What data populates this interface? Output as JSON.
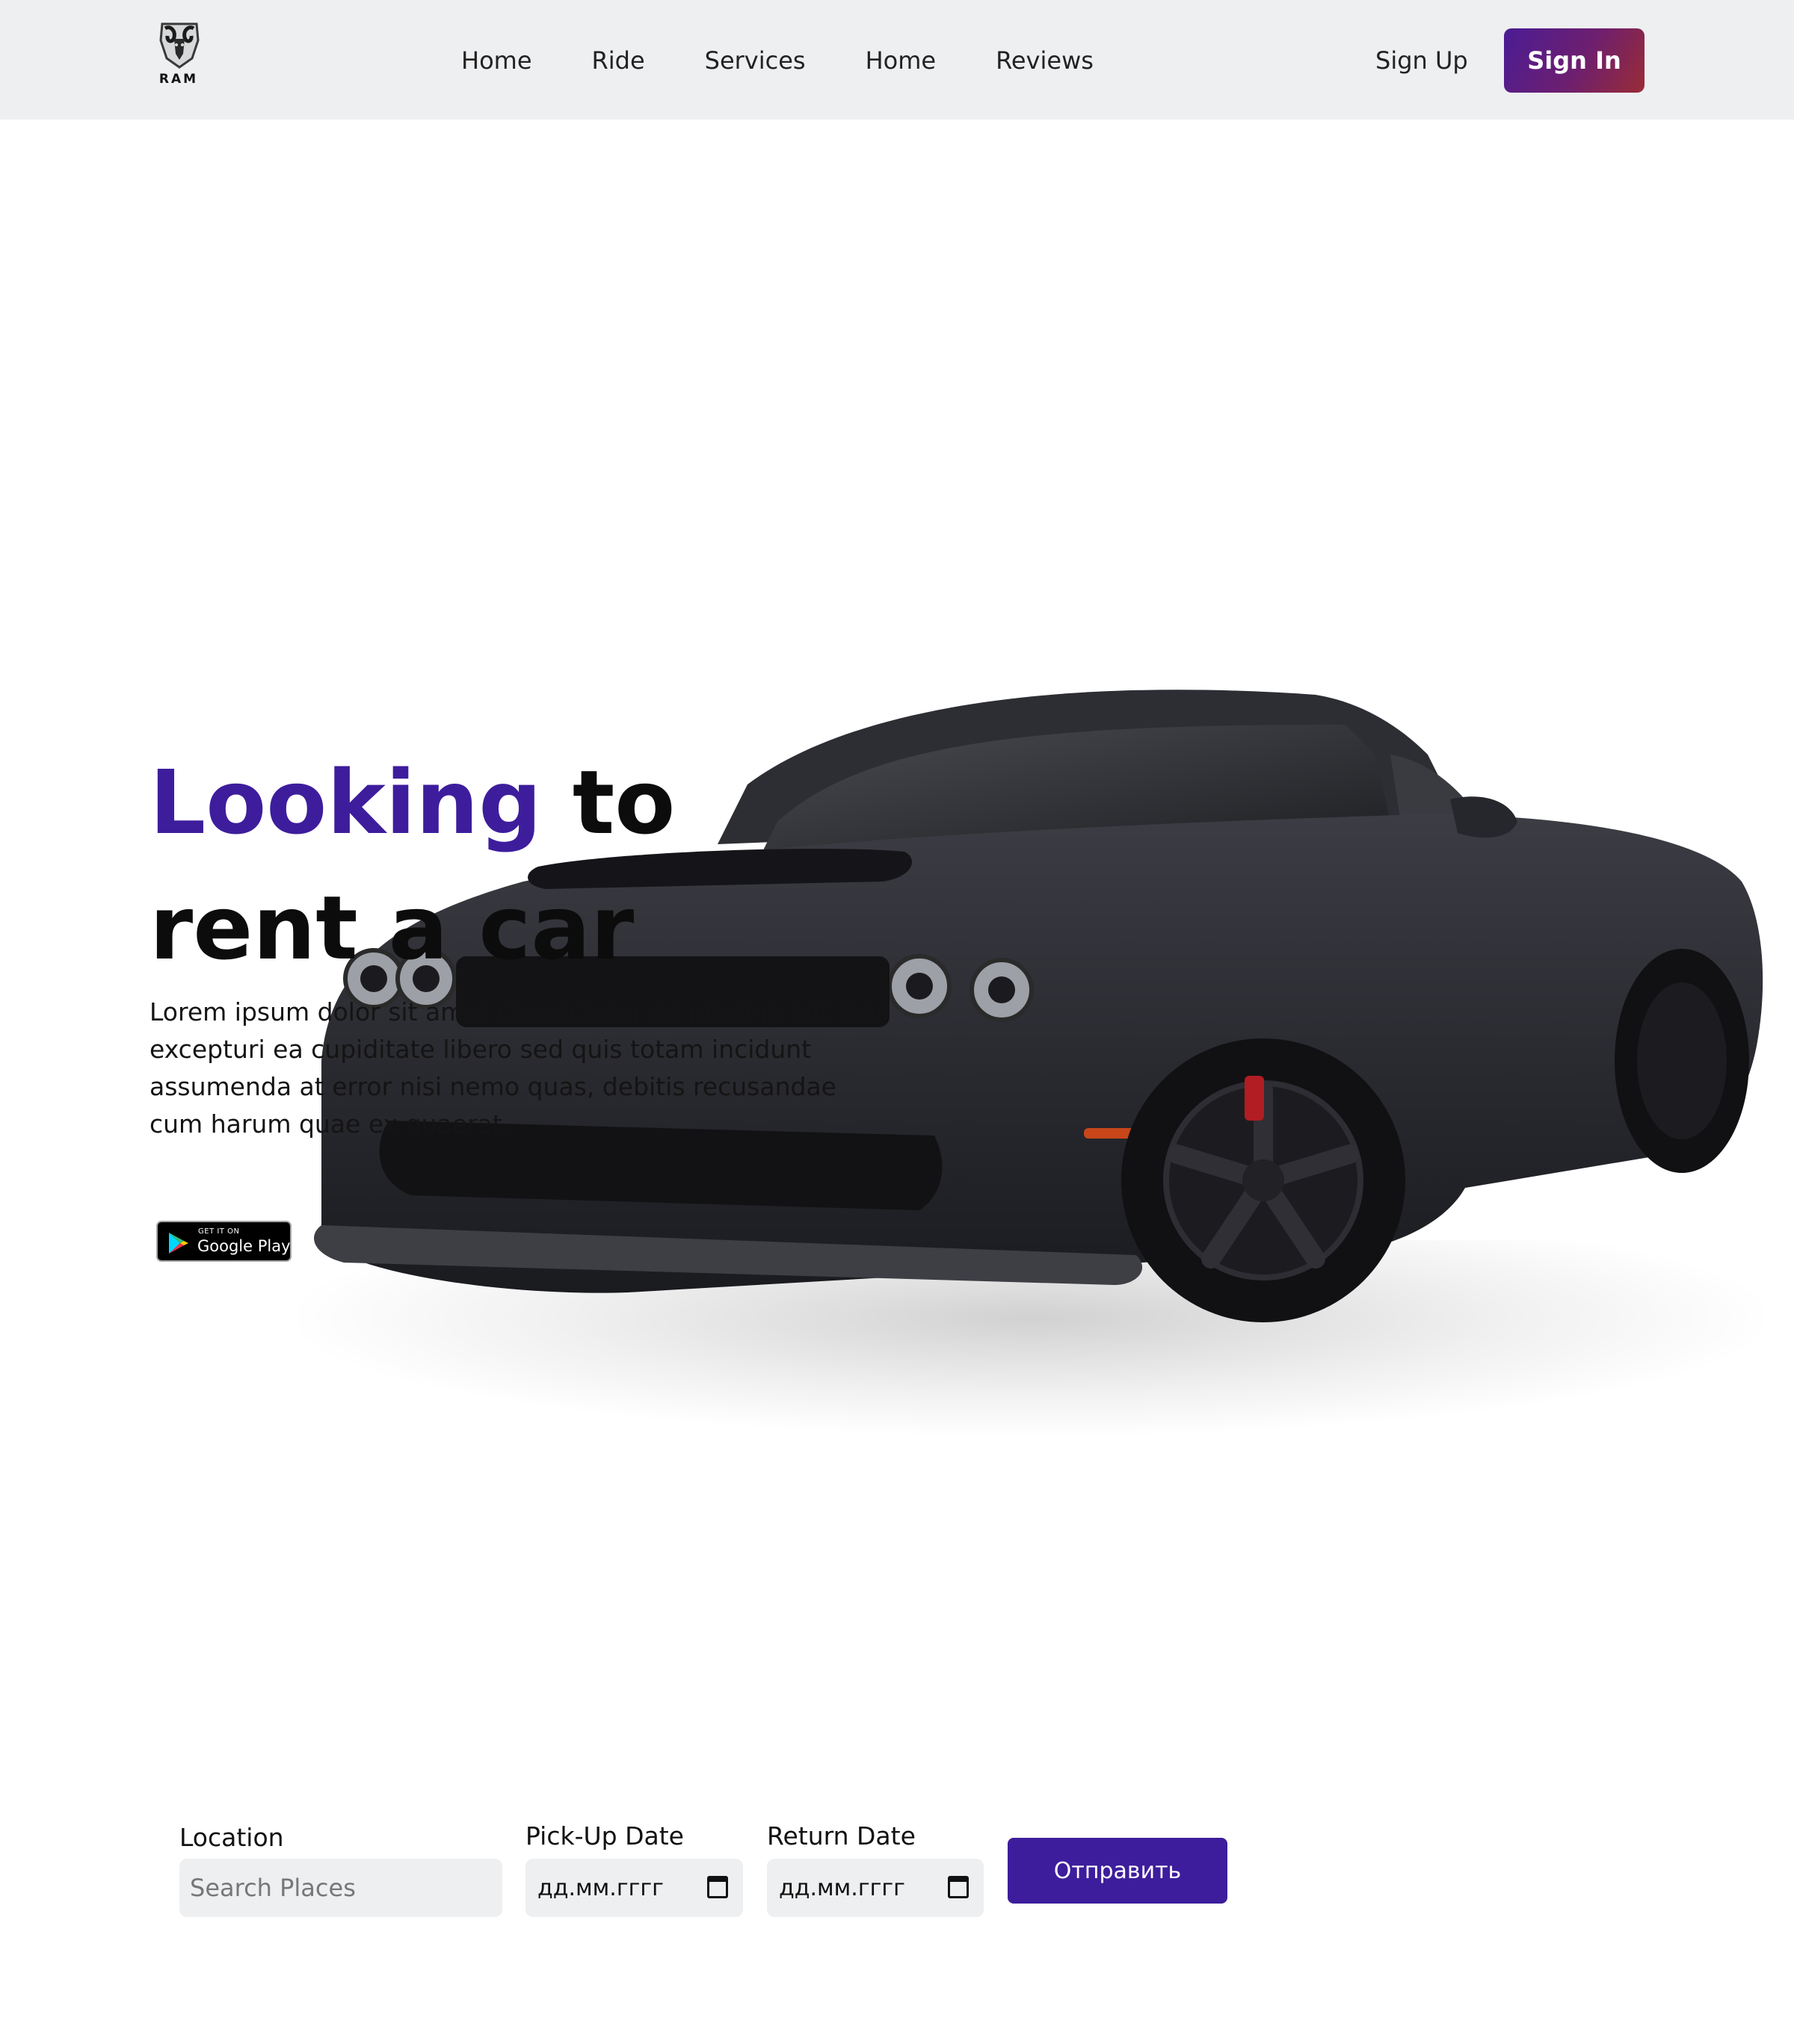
{
  "header": {
    "logo_text": "RAM",
    "nav": [
      "Home",
      "Ride",
      "Services",
      "Home",
      "Reviews"
    ],
    "sign_up": "Sign Up",
    "sign_in": "Sign In"
  },
  "hero": {
    "headline_accent": "Looking",
    "headline_rest_line1": " to",
    "headline_line2": "rent a car",
    "lead": "Lorem ipsum dolor sit amet consectetur adipisicing elit. Eos excepturi ea cupiditate libero sed quis totam incidunt assumenda at error nisi nemo quas, debitis recusandae cum harum quae ex quaerat.",
    "store_badge_small": "GET IT ON",
    "store_badge_big": "Google Play"
  },
  "form": {
    "location_label": "Location",
    "location_placeholder": "Search Places",
    "pickup_label": "Pick-Up Date",
    "pickup_value": "дд.мм.гггг",
    "return_label": "Return Date",
    "return_value": "дд.мм.гггг",
    "submit_label": "Отправить"
  },
  "colors": {
    "accent": "#3d1d9c",
    "header_bg": "#eeeff1",
    "sign_in_gradient": [
      "#4a1c95",
      "#9a2c35"
    ]
  },
  "icons": [
    "ram-logo-icon",
    "google-play-icon",
    "calendar-icon"
  ]
}
